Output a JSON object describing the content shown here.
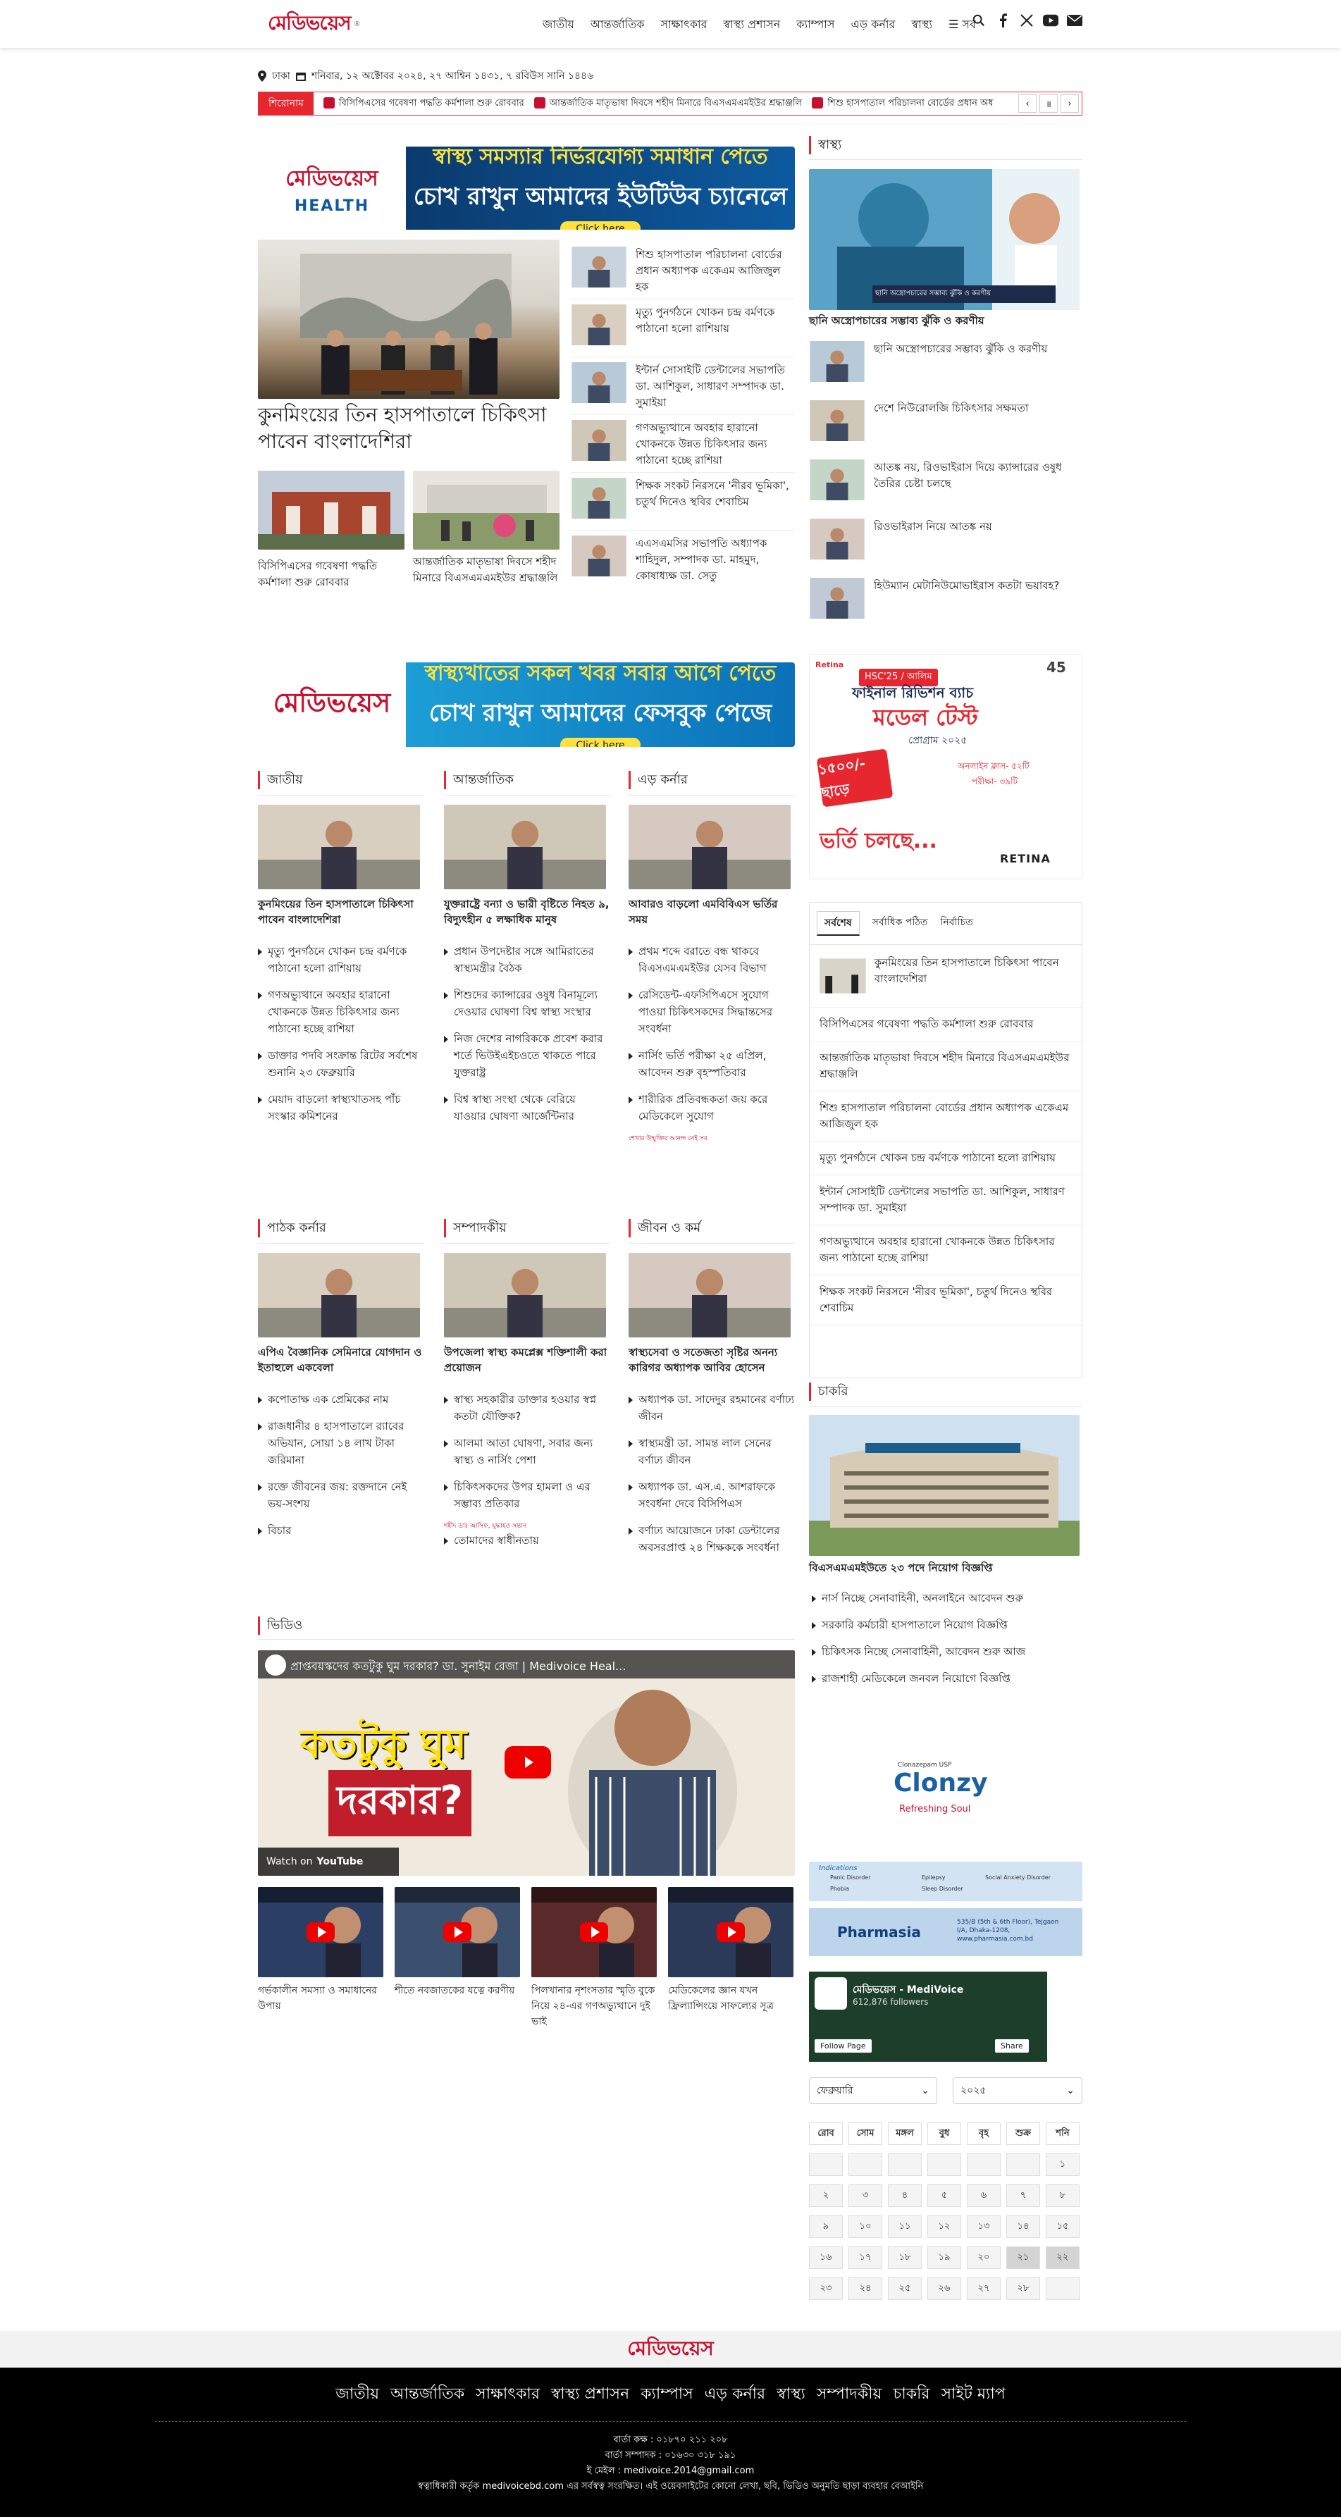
{
  "header": {
    "logo_text": "মেডিভয়েস",
    "nav": [
      "জাতীয়",
      "আন্তর্জাতিক",
      "সাক্ষাৎকার",
      "স্বাস্থ্য প্রশাসন",
      "ক্যাম্পাস",
      "এড় কর্নার",
      "স্বাস্থ্য",
      "সব"
    ],
    "icons": [
      "search-icon",
      "menu-icon",
      "facebook-icon",
      "x-icon",
      "youtube-icon",
      "mail-icon"
    ]
  },
  "date_bar": {
    "location": "ঢাকা",
    "date": "শনিবার, ১২ অক্টোবর ২০২৪, ২৭ আশ্বিন ১৪৩১, ৭ রবিউস সানি ১৪৪৬"
  },
  "ticker": {
    "label": "শিরোনাম",
    "items": [
      "বিসিপিএসের গবেষণা পদ্ধতি কর্মশালা শুরু রোববার",
      "আন্তর্জাতিক মাতৃভাষা দিবসে শহীদ মিনারে বিএসএমএমইউর শ্রদ্ধাঞ্জলি",
      "শিশু হাসপাতাল পরিচালনা বোর্ডের প্রধান অধ"
    ]
  },
  "banner1": {
    "brand": "মেডিভয়েস",
    "sub": "HEALTH",
    "line1": "স্বাস্থ্য সমস্যার নির্ভরযোগ্য সমাধান পেতে",
    "line2": "চোখ রাখুন আমাদের ইউটিউব চ্যানেলে",
    "cta": "Click here"
  },
  "banner2": {
    "brand": "মেডিভয়েস",
    "line1": "স্বাস্থ্যখাতের সকল খবর সবার আগে পেতে",
    "line2": "চোখ রাখুন আমাদের ফেসবুক পেজে",
    "cta": "Click here"
  },
  "lead": {
    "headline": "কুনমিংয়ের তিন হাসপাতালে চিকিৎসা পাবেন বাংলাদেশিরা",
    "sub1": "বিসিপিএসের গবেষণা পদ্ধতি কর্মশালা শুরু রোববার",
    "sub2": "আন্তর্জাতিক মাতৃভাষা দিবসে শহীদ মিনারে বিএসএমএমইউর শ্রদ্ধাঞ্জলি",
    "side": [
      "শিশু হাসপাতাল পরিচালনা বোর্ডের প্রধান অধ্যাপক একেএম আজিজুল হক",
      "মৃত্যু পুনর্গঠনে খোকন চন্দ্র বর্মণকে পাঠানো হলো রাশিয়ায়",
      "ইন্টার্ন সোসাইটি ডেন্টালের সভাপতি ডা. আশিকুল, সাধারণ সম্পাদক ডা. সুমাইয়া",
      "গণঅভ্যুত্থানে অবহার হারানো খোকনকে উন্নত চিকিৎসার জন্য পাঠানো হচ্ছে রাশিয়া",
      "শিক্ষক সংকট নিরসনে 'নীরব ভূমিকা', চতুর্থ দিনেও স্থবির শেবাচিম",
      "এএসএমসির সভাপতি অধ্যাপক শাহিদুল, সম্পাদক ডা. মাহমুদ, কোষাধ্যক্ষ ডা. সেতু"
    ]
  },
  "health": {
    "title": "স্বাস্থ্য",
    "hero_overlay": "ছানি অস্ত্রোপচারের সম্ভাব্য ঝুঁকি ও করণীয়",
    "hero_caption": "ছানি অস্ত্রোপচারের সম্ভাব্য ঝুঁকি ও করণীয়",
    "items": [
      "ছানি অস্ত্রোপচারের সম্ভাব্য ঝুঁকি ও করণীয়",
      "দেশে নিউরোলজি চিকিৎসার সক্ষমতা",
      "আতঙ্ক নয়, রিওভাইরাস দিয়ে ক্যান্সারের ওষুধ তৈরির চেষ্টা চলছে",
      "রিওভাইরাস নিয়ে আতঙ্ক নয়",
      "হিউম্যান মেটানিউমোভাইরাস কতটা ভয়াবহ?"
    ]
  },
  "ad_right": {
    "tag": "HSC'25 / আলিম",
    "line1": "ফাইনাল রিভিশন ব্যাচ",
    "line2": "মডেল টেস্ট",
    "line3": "প্রোগ্রাম ২০২৫",
    "offer": "১৫০০/- ছাড়ে",
    "f1": "অনলাইন ক্লাস- ৫২টি",
    "f2": "পরীক্ষা- ৩৯টি",
    "cta": "ভর্তি চলছে...",
    "brand": "RETINA",
    "badge": "45"
  },
  "sections_row1": [
    {
      "title": "জাতীয়",
      "lead": "কুনমিংয়ের তিন হাসপাতালে চিকিৎসা পাবেন বাংলাদেশিরা",
      "items": [
        "মৃত্যু পুনর্গঠনে খোকন চন্দ্র বর্মণকে পাঠানো হলো রাশিয়ায়",
        "গণঅভ্যুত্থানে অবহার হারানো খোকনকে উন্নত চিকিৎসার জন্য পাঠানো হচ্ছে রাশিয়া",
        "ডাক্তার পদবি সংক্রান্ত রিটের সর্বশেষ শুনানি ২৩ ফেব্রুয়ারি",
        "মেয়াদ বাড়লো স্বাস্থ্যখাতসহ পাঁচ সংস্কার কমিশনের"
      ]
    },
    {
      "title": "আন্তর্জাতিক",
      "lead": "যুক্তরাষ্ট্রে বন্যা ও ভারী বৃষ্টিতে নিহত ৯, বিদ্যুৎহীন ৫ লক্ষাধিক মানুষ",
      "items": [
        "প্রধান উপদেষ্টার সঙ্গে আমিরাতের স্বাস্থ্যমন্ত্রীর বৈঠক",
        "শিশুদের ক্যান্সারের ওষুধ বিনামূল্যে দেওয়ার ঘোষণা বিশ্ব স্বাস্থ্য সংস্থার",
        "নিজ দেশের নাগরিককে প্রবেশ করার শর্তে ভিউইএইচওতে থাকতে পারে যুক্তরাষ্ট্র",
        "বিশ্ব স্বাস্থ্য সংস্থা থেকে বেরিয়ে যাওয়ার ঘোষণা আর্জেন্টিনার"
      ]
    },
    {
      "title": "এড় কর্নার",
      "lead": "আবারও বাড়লো এমবিবিএস ভর্তির সময়",
      "items": [
        "প্রথম শব্দে বরাতে বন্ধ থাকবে বিএসএমএমইউর যেসব বিভাগ",
        "রেসিডেন্ট-এফসিপিএসে সুযোগ পাওয়া চিকিৎসকদের সিদ্ধান্তসের সংবর্ধনা",
        "নার্সিং ভর্তি পরীক্ষা ২৫ এপ্রিল, আবেদন শুরু বৃহস্পতিবার",
        "শারীরিক প্রতিবন্ধকতা জয় করে মেডিকেলে সুযোগ"
      ],
      "small": "শেখার উন্মুক্তির আনন্দ নেই সব"
    }
  ],
  "tabs": {
    "labels": [
      "সর্বশেষ",
      "সর্বাধিক পঠিত",
      "নির্বাচিত"
    ],
    "first": "কুনমিংয়ের তিন হাসপাতালে চিকিৎসা পাবেন বাংলাদেশিরা",
    "items": [
      "বিসিপিএসের গবেষণা পদ্ধতি কর্মশালা শুরু রোববার",
      "আন্তর্জাতিক মাতৃভাষা দিবসে শহীদ মিনারে বিএসএমএমইউর শ্রদ্ধাঞ্জলি",
      "শিশু হাসপাতাল পরিচালনা বোর্ডের প্রধান অধ্যাপক একেএম আজিজুল হক",
      "মৃত্যু পুনর্গঠনে খোকন চন্দ্র বর্মণকে পাঠানো হলো রাশিয়ায়",
      "ইন্টার্ন সোসাইটি ডেন্টালের সভাপতি ডা. আশিকুল, সাধারণ সম্পাদক ডা. সুমাইয়া",
      "গণঅভ্যুত্থানে অবহার হারানো খোকনকে উন্নত চিকিৎসার জন্য পাঠানো হচ্ছে রাশিয়া",
      "শিক্ষক সংকট নিরসনে 'নীরব ভূমিকা', চতুর্থ দিনেও স্থবির শেবাচিম"
    ]
  },
  "sections_row2": [
    {
      "title": "পাঠক কর্নার",
      "lead": "এপিএ বৈজ্ঞানিক সেমিনারে যোগদান ও ইতাহুলে একবেলা",
      "items": [
        "কপোতাক্ষ এক প্রেমিকের নাম",
        "রাজধানীর ৪ হাসপাতালে র‍্যাবের অভিযান, সোয়া ১৪ লাখ টাকা জরিমানা",
        "রক্তে জীবনের জয়: রক্তদানে নেই ভয়-সংশয়",
        "বিচার"
      ]
    },
    {
      "title": "সম্পাদকীয়",
      "lead": "উপজেলা স্বাস্থ্য কমপ্লেক্স শক্তিশালী করা প্রয়োজন",
      "items": [
        "স্বাস্থ্য সহকারীর ডাক্তার হওয়ার স্বপ্ন কতটা যৌক্তিক?",
        "আলমা আতা ঘোষণা, সবার জন্য স্বাস্থ্য ও নার্সিং পেশা",
        "চিকিৎসকদের উপর হামলা ও এর সম্ভাব্য প্রতিকার"
      ],
      "small": "শহীদ ডাঃ আসিফ, যুদ্ধাহত সন্তান",
      "last": "তোমাদের স্বাধীনতায়"
    },
    {
      "title": "জীবন ও কর্ম",
      "lead": "স্বাস্থ্যসেবা ও সতেজতা সৃষ্টির অনন্য কারিগর অধ্যাপক আবির হোসেন",
      "items": [
        "অধ্যাপক ডা. সাদেদুর রহমানের বর্ণাঢ্য জীবন",
        "স্বাস্থ্যমন্ত্রী ডা. সামন্ত লাল সেনের বর্ণাঢ্য জীবন",
        "অধ্যাপক ডা. এস.এ. আশরাফকে সংবর্ধনা দেবে বিসিপিএস",
        "বর্ণাঢ্য আয়োজনে ঢাকা ডেন্টালের অবসরপ্রাপ্ত ২৪ শিক্ষককে সংবর্ধনা"
      ]
    }
  ],
  "jobs": {
    "title": "চাকরি",
    "lead": "বিএসএমএমইউতে ২৩ পদে নিয়োগ বিজ্ঞপ্তি",
    "items": [
      "নার্স নিচ্ছে সেনাবাহিনী, অনলাইনে আবেদন শুরু",
      "সরকারি কর্মচারী হাসপাতালে নিয়োগ বিজ্ঞপ্তি",
      "চিকিৎসক নিচ্ছে সেনাবাহিনী, আবেদন শুরু আজ",
      "রাজশাহী মেডিকেলে জনবল নিয়োগে বিজ্ঞপ্তি"
    ]
  },
  "video": {
    "title": "ভিডিও",
    "main_title": "প্রাপ্তবয়স্কদের কতটুকু ঘুম দরকার? ডা. সুনাইম রেজা | Medivoice Heal...",
    "main_big1": "কতটুকু ঘুম",
    "main_big2": "দরকার?",
    "watch_on": "Watch on",
    "youtube": "YouTube",
    "thumbs": [
      "গর্ভকালীন সমস্যা ও সমাধানের উপায়",
      "শীতে নবজাতকের যত্নে করণীয়",
      "পিলখানার নৃশংসতার স্মৃতি বুকে নিয়ে ২৪-এর গণঅভ্যুত্থানে দুই ভাই",
      "মেডিকেলের জ্ঞান যখন ফ্রিল্যান্সিংয়ে সাফল্যের সূত্র"
    ]
  },
  "ads": {
    "clonzy": "Clonzy",
    "clonzy_sub": "Refreshing Soul",
    "clonzy_lbl": "Clonazepam USP",
    "indications": "Indications",
    "ind_items": [
      "Panic Disorder",
      "Epilepsy",
      "Social Anxiety Disorder",
      "Phobia",
      "Sleep Disorder"
    ],
    "pharmasia": "Pharmasia",
    "pharmasia_addr": "535/B (5th & 6th Floor), Tejgaon I/A, Dhaka-1208, www.pharmasia.com.bd"
  },
  "fb": {
    "name": "মেডিভয়েস - MediVoice",
    "followers": "612,876 followers",
    "follow": "Follow Page",
    "share": "Share"
  },
  "calendar": {
    "month": "ফেব্রুয়ারি",
    "year": "২০২৫",
    "days": [
      "রোব",
      "সোম",
      "মঙ্গল",
      "বুধ",
      "বৃহ",
      "শুক্র",
      "শনি"
    ],
    "dates": [
      "",
      "",
      "",
      "",
      "",
      "",
      "১",
      "২",
      "৩",
      "৪",
      "৫",
      "৬",
      "৭",
      "৮",
      "৯",
      "১০",
      "১১",
      "১২",
      "১৩",
      "১৪",
      "১৫",
      "১৬",
      "১৭",
      "১৮",
      "১৯",
      "২০",
      "২১",
      "২২",
      "২৩",
      "২৪",
      "২৫",
      "২৬",
      "২৭",
      "২৮",
      ""
    ]
  },
  "footer": {
    "logo": "মেডিভয়েস",
    "nav": [
      "জাতীয়",
      "আন্তর্জাতিক",
      "সাক্ষাৎকার",
      "স্বাস্থ্য প্রশাসন",
      "ক্যাম্পাস",
      "এড় কর্নার",
      "স্বাস্থ্য",
      "সম্পাদকীয়",
      "চাকরি",
      "সাইট ম্যাপ"
    ],
    "l1": "বার্তা কক্ষ : ০১৮৭০ ২১১ ২০৮",
    "l2": "বার্তা সম্পাদক : ০১৬৩০ ৩১৮ ১৯১",
    "l3": "ই মেইল : medivoice.2014@gmail.com",
    "l4": "স্বত্বাধিকারী কর্তৃক medivoicebd.com এর সর্বস্বত্ব সংরক্ষিত। এই ওয়েবসাইটের কোনো লেখা, ছবি, ভিডিও অনুমতি ছাড়া ব্যবহার বেআইনি"
  }
}
